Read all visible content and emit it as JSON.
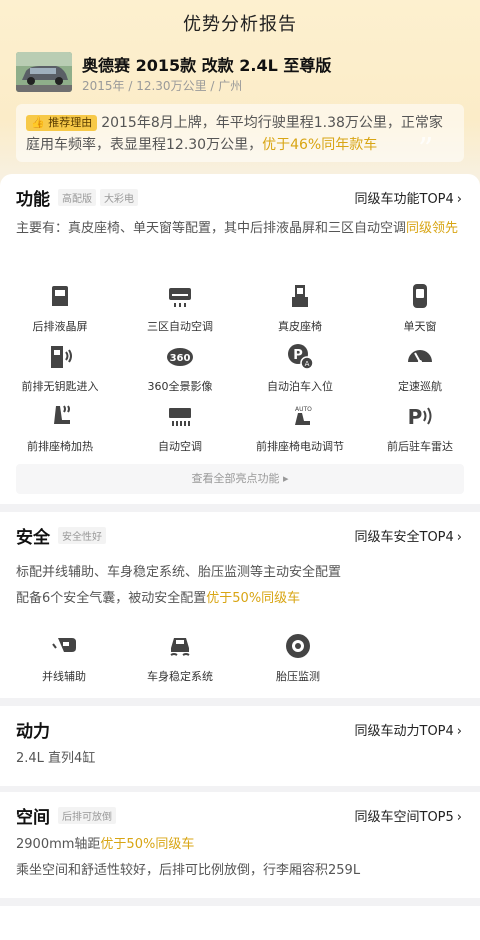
{
  "header": {
    "title": "优势分析报告"
  },
  "car": {
    "name": "奥德赛 2015款 改款 2.4L 至尊版",
    "meta": "2015年 / 12.30万公里 / 广州"
  },
  "reason": {
    "badge": "推荐理由",
    "text": "2015年8月上牌，年平均行驶里程1.38万公里，正常家庭用车频率，表显里程12.30万公里，",
    "highlight": "优于46%同年款车"
  },
  "function": {
    "title": "功能",
    "tags": [
      "高配版",
      "大彩电"
    ],
    "rank": "同级车功能TOP4",
    "desc": "主要有：真皮座椅、单天窗等配置，其中后排液晶屏和三区自动空调",
    "desc_highlight": "同级领先",
    "items": [
      {
        "label": "后排液晶屏",
        "icon": "rear-screen-icon"
      },
      {
        "label": "三区自动空调",
        "icon": "air-conditioner-icon"
      },
      {
        "label": "真皮座椅",
        "icon": "leather-seat-icon"
      },
      {
        "label": "单天窗",
        "icon": "sunroof-icon"
      },
      {
        "label": "前排无钥匙进入",
        "icon": "keyless-entry-icon"
      },
      {
        "label": "360全景影像",
        "icon": "panoramic-camera-icon"
      },
      {
        "label": "自动泊车入位",
        "icon": "auto-parking-icon"
      },
      {
        "label": "定速巡航",
        "icon": "cruise-control-icon"
      },
      {
        "label": "前排座椅加热",
        "icon": "seat-heating-icon"
      },
      {
        "label": "自动空调",
        "icon": "auto-ac-icon"
      },
      {
        "label": "前排座椅电动调节",
        "icon": "power-seat-icon"
      },
      {
        "label": "前后驻车雷达",
        "icon": "parking-radar-icon"
      }
    ],
    "view_all": "查看全部亮点功能"
  },
  "safety": {
    "title": "安全",
    "tags": [
      "安全性好"
    ],
    "rank": "同级车安全TOP4",
    "desc1": "标配并线辅助、车身稳定系统、胎压监测等主动安全配置",
    "desc2": "配备6个安全气囊，被动安全配置",
    "desc2_highlight": "优于50%同级车",
    "items": [
      {
        "label": "并线辅助",
        "icon": "lane-assist-icon"
      },
      {
        "label": "车身稳定系统",
        "icon": "stability-control-icon"
      },
      {
        "label": "胎压监测",
        "icon": "tire-pressure-icon"
      }
    ]
  },
  "power": {
    "title": "动力",
    "rank": "同级车动力TOP4",
    "desc": "2.4L 直列4缸"
  },
  "space": {
    "title": "空间",
    "tags": [
      "后排可放倒"
    ],
    "rank": "同级车空间TOP5",
    "desc1": "2900mm轴距",
    "desc1_highlight": "优于50%同级车",
    "desc2": "乘坐空间和舒适性较好，后排可比例放倒，行李厢容积259L"
  },
  "colors": {
    "accent": "#d8a514",
    "badge": "#f7c948",
    "icon": "#444444"
  }
}
